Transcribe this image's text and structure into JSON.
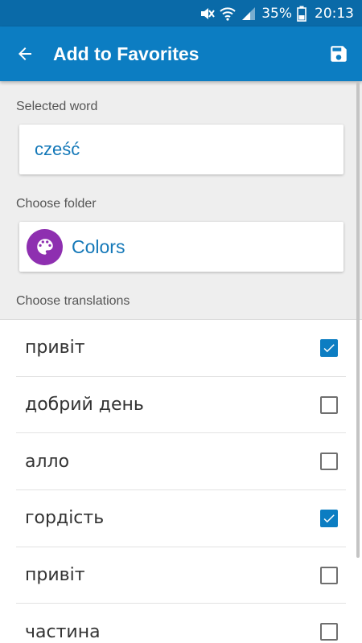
{
  "status_bar": {
    "battery_percent": "35%",
    "time": "20:13",
    "icons": [
      "mute-icon",
      "wifi-icon",
      "signal-icon",
      "battery-icon"
    ]
  },
  "app_bar": {
    "title": "Add to Favorites",
    "back_icon": "arrow-back-icon",
    "save_icon": "save-icon"
  },
  "selected_word": {
    "label": "Selected word",
    "value": "cześć"
  },
  "folder": {
    "label": "Choose folder",
    "name": "Colors",
    "icon": "palette-icon",
    "icon_color": "#8e2fb0"
  },
  "translations": {
    "label": "Choose translations",
    "items": [
      {
        "text": "привіт",
        "checked": true
      },
      {
        "text": "добрий день",
        "checked": false
      },
      {
        "text": "алло",
        "checked": false
      },
      {
        "text": "гордість",
        "checked": true
      },
      {
        "text": "привіт",
        "checked": false
      },
      {
        "text": "частина",
        "checked": false
      }
    ]
  },
  "colors": {
    "status_bar": "#0a6aa8",
    "app_bar": "#0c7dc2",
    "accent_text": "#1478b8",
    "checkbox_checked": "#0c7dc2"
  }
}
